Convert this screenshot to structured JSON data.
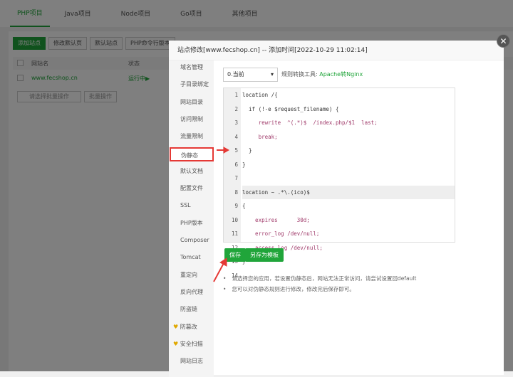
{
  "tabs": [
    "PHP项目",
    "Java项目",
    "Node项目",
    "Go项目",
    "其他项目"
  ],
  "toolbar": [
    "添加站点",
    "修改默认页",
    "默认站点",
    "PHP命令行版本"
  ],
  "table": {
    "headers": [
      "网站名",
      "状态"
    ],
    "row": {
      "name": "www.fecshop.cn",
      "status": "运行中▶"
    }
  },
  "batch": {
    "select": "请选择批量操作",
    "button": "批量操作"
  },
  "dialog": {
    "title": "站点修改[www.fecshop.cn] -- 添加时间[2022-10-29 11:02:14]",
    "menu": [
      "域名管理",
      "子目录绑定",
      "网站目录",
      "访问限制",
      "流量限制",
      "伪静态",
      "默认文档",
      "配置文件",
      "SSL",
      "PHP版本",
      "Composer",
      "Tomcat",
      "重定向",
      "反向代理",
      "防盗链",
      "防篡改",
      "安全扫描",
      "网站日志"
    ],
    "active_menu": "伪静态",
    "version_select": "0.当前",
    "tool_label": "规则转换工具:",
    "tool_link": "Apache转Nginx",
    "code": [
      "location /{",
      "  if (!-e $request_filename) {",
      "     rewrite  ^(.*)$  /index.php/$1  last;",
      "     break;",
      "  }",
      "}",
      "",
      "location ~ .*\\.(ico)$",
      "{",
      "    expires      30d;",
      "    error_log /dev/null;",
      "    access_log /dev/null;",
      "}",
      ""
    ],
    "save": "保存",
    "save_template": "另存为模板",
    "notes": [
      "请选择您的应用，若设置伪静态后，网站无法正常访问，请尝试设置回default",
      "您可以对伪静态规则进行修改，修改完后保存即可。"
    ]
  },
  "colors": {
    "accent": "#20a53a",
    "annotation": "#e53935"
  }
}
